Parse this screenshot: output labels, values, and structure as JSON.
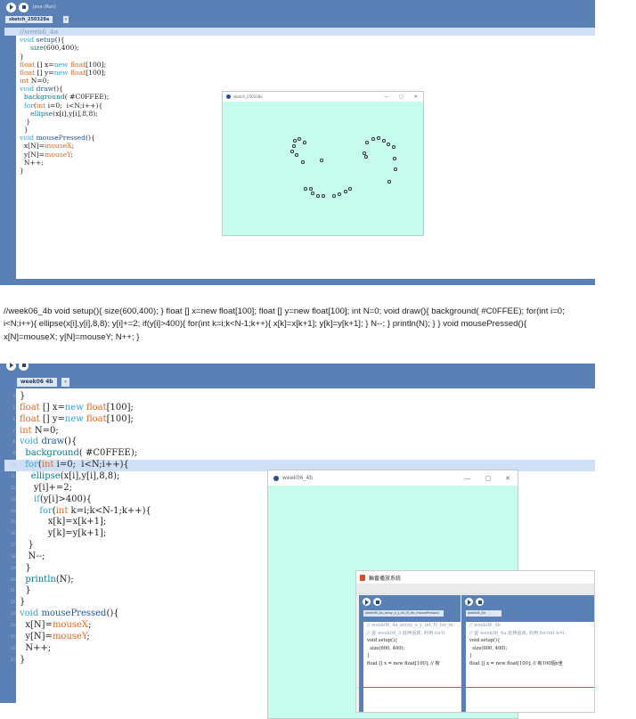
{
  "top": {
    "toolbar_title": "Java (Run)",
    "tab_name": "sketch_250328a",
    "tab_more": "▾",
    "lines": [
      [
        [
          "//week6_4a",
          "cm"
        ]
      ],
      [
        [
          "void ",
          "kw"
        ],
        [
          "setup",
          "kb"
        ],
        [
          "(){",
          "tx"
        ]
      ],
      [
        [
          "     ",
          "tx"
        ],
        [
          "size",
          "fn"
        ],
        [
          "(600,400);",
          "tx"
        ]
      ],
      [
        [
          "}",
          "tx"
        ]
      ],
      [
        [
          "float",
          "ty"
        ],
        [
          " [] x=",
          "tx"
        ],
        [
          "new",
          "kw"
        ],
        [
          " ",
          "tx"
        ],
        [
          "float",
          "ty"
        ],
        [
          "[100];",
          "tx"
        ]
      ],
      [
        [
          "float",
          "ty"
        ],
        [
          " [] y=",
          "tx"
        ],
        [
          "new",
          "kw"
        ],
        [
          " ",
          "tx"
        ],
        [
          "float",
          "ty"
        ],
        [
          "[100];",
          "tx"
        ]
      ],
      [
        [
          "int",
          "ty"
        ],
        [
          " N=0;",
          "tx"
        ]
      ],
      [
        [
          "void ",
          "kw"
        ],
        [
          "draw",
          "kb"
        ],
        [
          "(){",
          "tx"
        ]
      ],
      [
        [
          "  ",
          "tx"
        ],
        [
          "background",
          "fn"
        ],
        [
          "( #C0FFEE);",
          "tx"
        ]
      ],
      [
        [
          "  ",
          "tx"
        ],
        [
          "for",
          "kw"
        ],
        [
          "(",
          "tx"
        ],
        [
          "int",
          "ty"
        ],
        [
          " i=0;  i<N;i++){",
          "tx"
        ]
      ],
      [
        [
          "     ",
          "tx"
        ],
        [
          "ellipse",
          "fn"
        ],
        [
          "(x[i],y[i],8,8);",
          "tx"
        ]
      ],
      [
        [
          "   }",
          "tx"
        ]
      ],
      [
        [
          "  }",
          "tx"
        ]
      ],
      [
        [
          "void ",
          "kw"
        ],
        [
          "mousePressed",
          "kb"
        ],
        [
          "(){",
          "tx"
        ]
      ],
      [
        [
          "  x[N]=",
          "tx"
        ],
        [
          "mouseX",
          "ty"
        ],
        [
          ";",
          "tx"
        ]
      ],
      [
        [
          "  y[N]=",
          "tx"
        ],
        [
          "mouseY",
          "ty"
        ],
        [
          ";",
          "tx"
        ]
      ],
      [
        [
          "  N++;",
          "tx"
        ]
      ],
      [
        [
          "}",
          "tx"
        ]
      ]
    ],
    "sketch_window_title": "sketch_250328a",
    "win_min": "—",
    "win_max": "▢",
    "win_close": "✕"
  },
  "prose": "//week06_4b void setup(){ size(600,400); } float [] x=new float[100]; float [] y=new float[100]; int N=0; void draw(){ background( #C0FFEE); for(int i=0; i<N;i++){ ellipse(x[i],y[i],8,8); y[i]+=2; if(y[i]>400){ for(int k=i;k<N-1;k++){ x[k]=x[k+1]; y[k]=y[k+1]; } N--; } println(N); } } void mousePressed(){ x[N]=mouseX; y[N]=mouseY; N++; }",
  "bottom": {
    "tab_name": "week06 4b",
    "tab_more": "▾",
    "lines": [
      [
        [
          "}",
          "tx"
        ]
      ],
      [
        [
          "float",
          "ty"
        ],
        [
          " [] x=",
          "tx"
        ],
        [
          "new",
          "kw"
        ],
        [
          " ",
          "tx"
        ],
        [
          "float",
          "ty"
        ],
        [
          "[100];",
          "tx"
        ]
      ],
      [
        [
          "float",
          "ty"
        ],
        [
          " [] y=",
          "tx"
        ],
        [
          "new",
          "kw"
        ],
        [
          " ",
          "tx"
        ],
        [
          "float",
          "ty"
        ],
        [
          "[100];",
          "tx"
        ]
      ],
      [
        [
          "int",
          "ty"
        ],
        [
          " N=0;",
          "tx"
        ]
      ],
      [
        [
          "void ",
          "kw"
        ],
        [
          "draw",
          "kb"
        ],
        [
          "(){",
          "tx"
        ]
      ],
      [
        [
          "  ",
          "tx"
        ],
        [
          "background",
          "fn"
        ],
        [
          "( #C0FFEE);",
          "tx"
        ]
      ],
      [
        [
          "  ",
          "tx"
        ],
        [
          "for",
          "kw"
        ],
        [
          "(",
          "tx"
        ],
        [
          "int",
          "ty"
        ],
        [
          " i=0;  i<N;i++){",
          "tx"
        ]
      ],
      [
        [
          "    ",
          "tx"
        ],
        [
          "ellipse",
          "fn"
        ],
        [
          "(x[i],y[i],8,8);",
          "tx"
        ]
      ],
      [
        [
          "     y[i]+=2;",
          "tx"
        ]
      ],
      [
        [
          "     ",
          "tx"
        ],
        [
          "if",
          "kw"
        ],
        [
          "(y[i]>400){",
          "tx"
        ]
      ],
      [
        [
          "       ",
          "tx"
        ],
        [
          "for",
          "kw"
        ],
        [
          "(",
          "tx"
        ],
        [
          "int",
          "ty"
        ],
        [
          " k=i;k<N-1;k++){",
          "tx"
        ]
      ],
      [
        [
          "          x[k]=x[k+1];",
          "tx"
        ]
      ],
      [
        [
          "          y[k]=y[k+1];",
          "tx"
        ]
      ],
      [
        [
          "   }",
          "tx"
        ]
      ],
      [
        [
          "   N--;",
          "tx"
        ]
      ],
      [
        [
          "  }",
          "tx"
        ]
      ],
      [
        [
          "  ",
          "tx"
        ],
        [
          "println",
          "fn"
        ],
        [
          "(N);",
          "tx"
        ]
      ],
      [
        [
          "  }",
          "tx"
        ]
      ],
      [
        [
          "}",
          "tx"
        ]
      ],
      [
        [
          "void ",
          "kw"
        ],
        [
          "mousePressed",
          "kb"
        ],
        [
          "(){",
          "tx"
        ]
      ],
      [
        [
          "  x[N]=",
          "tx"
        ],
        [
          "mouseX",
          "ty"
        ],
        [
          ";",
          "tx"
        ]
      ],
      [
        [
          "  y[N]=",
          "tx"
        ],
        [
          "mouseY",
          "ty"
        ],
        [
          ";",
          "tx"
        ]
      ],
      [
        [
          "  N++;",
          "tx"
        ]
      ],
      [
        [
          "}",
          "tx"
        ]
      ]
    ],
    "line_numbers": [
      "4",
      "5",
      "6",
      "7",
      "8",
      "9",
      "10",
      "11",
      "12",
      "13",
      "14",
      "15",
      "16",
      "17",
      "18",
      "19",
      "20",
      "21",
      "22",
      "23",
      "24",
      "25",
      "26",
      "27"
    ],
    "sketch_window_title": "week06_4b",
    "win_min": "—",
    "win_max": "▢",
    "win_close": "✕",
    "popup": {
      "title": "輪番播放系統",
      "left_tab": "week06_4a_array_x_y_int_N_for_mousePressed",
      "left_lines": [
        "// week06_4a_array_x_y_int_N_for_m",
        "// 從 week04_3 延伸過來, 利用 for(i",
        "void setup(){",
        "  size(600, 400);",
        "}",
        "float [] x = new float[100]; // 有"
      ],
      "right_tab": "week06_4b",
      "right_lines": [
        "// week06_4b",
        "// 從 week06_4a 延伸過來, 利用 for(int k=i;",
        "void setup(){",
        "  size(600, 400);",
        "}",
        "float [] x = new float[100]; // 有100個x坐"
      ]
    }
  }
}
